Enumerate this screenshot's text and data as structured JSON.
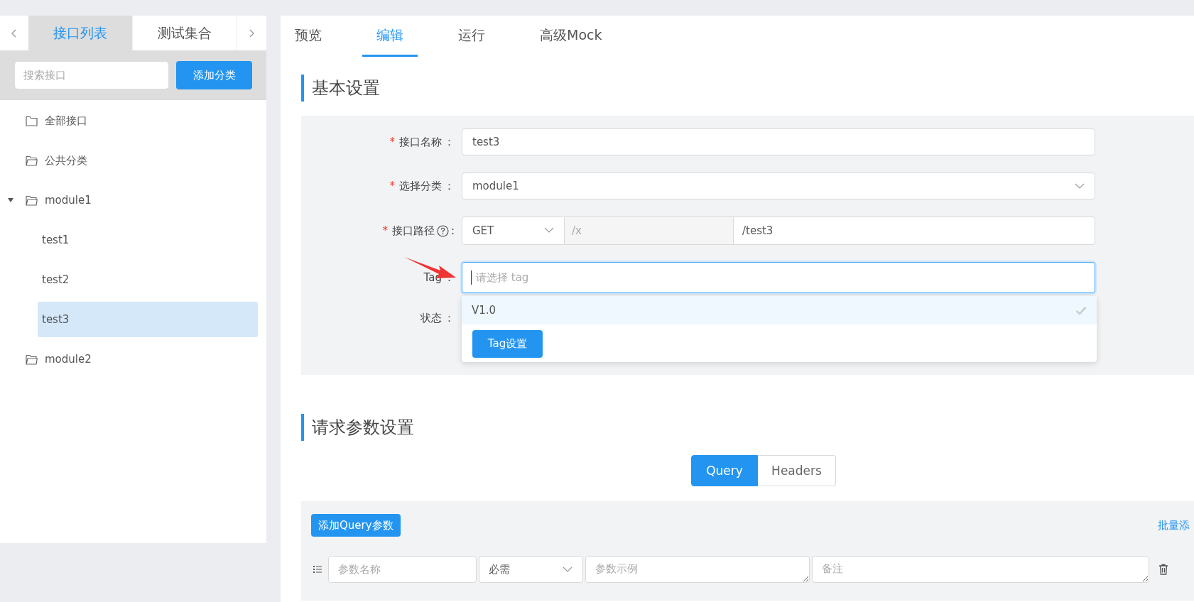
{
  "sidebar": {
    "tabs": [
      {
        "label": "接口列表",
        "selected": true
      },
      {
        "label": "测试集合",
        "selected": false
      }
    ],
    "search": {
      "placeholder": "搜索接口"
    },
    "add_button": "添加分类",
    "tree": [
      {
        "label": "全部接口",
        "kind": "folder",
        "selected": false
      },
      {
        "label": "公共分类",
        "kind": "folder-open",
        "selected": false
      },
      {
        "label": "module1",
        "kind": "folder-open",
        "selected": false,
        "expanded": true,
        "children": [
          {
            "label": "test1",
            "selected": false
          },
          {
            "label": "test2",
            "selected": false
          },
          {
            "label": "test3",
            "selected": true
          }
        ]
      },
      {
        "label": "module2",
        "kind": "folder-open",
        "selected": false
      }
    ]
  },
  "tabs": [
    {
      "label": "预览",
      "selected": false
    },
    {
      "label": "编辑",
      "selected": true
    },
    {
      "label": "运行",
      "selected": false
    },
    {
      "label": "高级Mock",
      "selected": false
    }
  ],
  "basic": {
    "title": "基本设置",
    "fields": [
      {
        "kind": "text",
        "required_mark": "*",
        "label": "接口名称",
        "colon": "：",
        "value": "test3"
      },
      {
        "kind": "select",
        "required_mark": "*",
        "label": "选择分类",
        "colon": "：",
        "value": "module1"
      },
      {
        "kind": "path",
        "required_mark": "*",
        "label": "接口路径",
        "colon": ":",
        "method": "GET",
        "prefix": "/x",
        "value": "/test3"
      },
      {
        "kind": "tag",
        "label": "Tag",
        "colon": "：",
        "placeholder": "请选择 tag",
        "focused": true,
        "options": [
          {
            "label": "V1.0",
            "selected": true
          }
        ],
        "action": "Tag设置"
      },
      {
        "kind": "status",
        "label": "状态",
        "colon": "："
      }
    ]
  },
  "params": {
    "title": "请求参数设置",
    "segments": [
      {
        "label": "Query",
        "selected": true
      },
      {
        "label": "Headers",
        "selected": false
      }
    ],
    "add_button": "添加Query参数",
    "batch_link": "批量添",
    "row": {
      "name_placeholder": "参数名称",
      "required": "必需",
      "example_placeholder": "参数示例",
      "note_placeholder": "备注"
    }
  }
}
